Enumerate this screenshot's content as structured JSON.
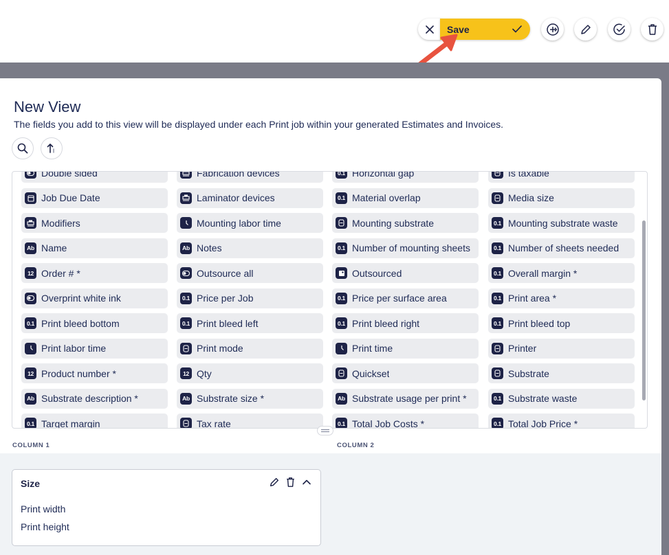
{
  "toolbar": {
    "save_label": "Save",
    "icons": [
      "close-icon",
      "check-icon",
      "add-circle-icon",
      "pencil-icon",
      "check-circle-icon",
      "trash-icon"
    ]
  },
  "view": {
    "title": "New View",
    "description": "The fields you add to this view will be displayed under each Print job within your generated Estimates and Invoices."
  },
  "fields": [
    {
      "label": "Double sided",
      "icon": "toggle"
    },
    {
      "label": "Fabrication devices",
      "icon": "device"
    },
    {
      "label": "Horizontal gap",
      "icon": "0.1"
    },
    {
      "label": "Is taxable",
      "icon": "lock"
    },
    {
      "label": "Job Due Date",
      "icon": "calendar"
    },
    {
      "label": "Laminator devices",
      "icon": "device"
    },
    {
      "label": "Material overlap",
      "icon": "0.1"
    },
    {
      "label": "Media size",
      "icon": "lock"
    },
    {
      "label": "Modifiers",
      "icon": "device"
    },
    {
      "label": "Mounting labor time",
      "icon": "clock"
    },
    {
      "label": "Mounting substrate",
      "icon": "lock"
    },
    {
      "label": "Mounting substrate waste",
      "icon": "0.1"
    },
    {
      "label": "Name",
      "icon": "Ab"
    },
    {
      "label": "Notes",
      "icon": "Ab"
    },
    {
      "label": "Number of mounting sheets",
      "icon": "0.1"
    },
    {
      "label": "Number of sheets needed",
      "icon": "0.1"
    },
    {
      "label": "Order # *",
      "icon": "12"
    },
    {
      "label": "Outsource all",
      "icon": "toggle"
    },
    {
      "label": "Outsourced",
      "icon": "image"
    },
    {
      "label": "Overall margin *",
      "icon": "0.1"
    },
    {
      "label": "Overprint white ink",
      "icon": "toggle"
    },
    {
      "label": "Price per Job",
      "icon": "0.1"
    },
    {
      "label": "Price per surface area",
      "icon": "0.1"
    },
    {
      "label": "Print area *",
      "icon": "0.1"
    },
    {
      "label": "Print bleed bottom",
      "icon": "0.1"
    },
    {
      "label": "Print bleed left",
      "icon": "0.1"
    },
    {
      "label": "Print bleed right",
      "icon": "0.1"
    },
    {
      "label": "Print bleed top",
      "icon": "0.1"
    },
    {
      "label": "Print labor time",
      "icon": "clock"
    },
    {
      "label": "Print mode",
      "icon": "lock"
    },
    {
      "label": "Print time",
      "icon": "clock"
    },
    {
      "label": "Printer",
      "icon": "lock"
    },
    {
      "label": "Product number *",
      "icon": "12"
    },
    {
      "label": "Qty",
      "icon": "12"
    },
    {
      "label": "Quickset",
      "icon": "lock"
    },
    {
      "label": "Substrate",
      "icon": "lock"
    },
    {
      "label": "Substrate description *",
      "icon": "Ab"
    },
    {
      "label": "Substrate size *",
      "icon": "Ab"
    },
    {
      "label": "Substrate usage per print *",
      "icon": "Ab"
    },
    {
      "label": "Substrate waste",
      "icon": "0.1"
    },
    {
      "label": "Target margin",
      "icon": "0.1"
    },
    {
      "label": "Tax rate",
      "icon": "lock"
    },
    {
      "label": "Total Job Costs *",
      "icon": "0.1"
    },
    {
      "label": "Total Job Price *",
      "icon": "0.1"
    }
  ],
  "columns": {
    "column1_label": "COLUMN 1",
    "column2_label": "COLUMN 2"
  },
  "card": {
    "title": "Size",
    "rows": [
      "Print width",
      "Print height"
    ]
  },
  "colors": {
    "accent": "#f7c21a",
    "text": "#1e2a55",
    "icon_bg": "#1e2347",
    "chip_bg": "#ebecef",
    "arrow": "#e8533f"
  }
}
